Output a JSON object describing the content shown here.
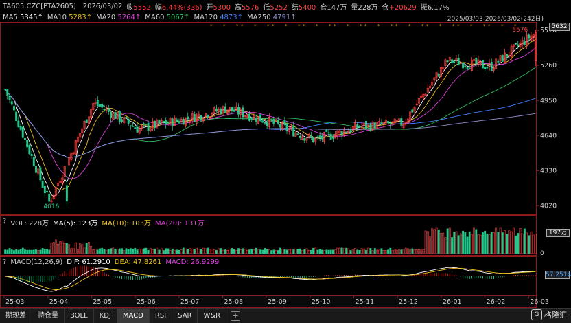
{
  "header": {
    "symbol": "TA605.CZC[PTA2605]",
    "date": "2026/03/02",
    "close_label": "收",
    "close": "5552",
    "change_label": "幅",
    "change": "6.44%(336)",
    "open_label": "开",
    "open": "5300",
    "high_label": "高",
    "high": "5576",
    "low_label": "低",
    "low": "5252",
    "settle_label": "结",
    "settle": "5400",
    "oi_label": "仓",
    "oi": "147万",
    "vol_label": "量",
    "vol": "228万",
    "oichg_label": "仓",
    "oichg": "+20629",
    "amp_label": "振",
    "amp": "6.17%"
  },
  "ma_row": {
    "items": [
      {
        "label": "MA5",
        "value": "5345↑",
        "color": "#ffffff"
      },
      {
        "label": "MA10",
        "value": "5283↑",
        "color": "#f0c020"
      },
      {
        "label": "MA20",
        "value": "5264↑",
        "color": "#e040e0"
      },
      {
        "label": "MA60",
        "value": "5067↑",
        "color": "#30c060"
      },
      {
        "label": "MA120",
        "value": "4873↑",
        "color": "#4080ff"
      },
      {
        "label": "MA250",
        "value": "4791↑",
        "color": "#9090d0"
      }
    ],
    "range_text": "2025/03/03-2026/03/02(242日)"
  },
  "price_axis": [
    "5570",
    "5260",
    "4950",
    "4640",
    "4330",
    "4020"
  ],
  "price_box": "5632",
  "annotations": {
    "high_label": "5576",
    "low_label": "4016"
  },
  "vol_panel": {
    "title": "VOL: 228万",
    "ma5": "MA(5): 123万",
    "ma10": "MA(10): 103万",
    "ma20": "MA(20): 131万",
    "axis_box": "197万",
    "axis_zero": "0"
  },
  "macd_panel": {
    "title": "MACD(12,26,9)",
    "dif": "DIF: 61.2910",
    "dea": "DEA: 47.8261",
    "macd": "MACD: 26.9299",
    "axis_box": "57.2514"
  },
  "date_axis": [
    "25-03",
    "25-04",
    "25-05",
    "25-06",
    "25-07",
    "25-08",
    "25-09",
    "25-10",
    "25-11",
    "25-12",
    "26-01",
    "26-02",
    "26-03"
  ],
  "tabs": [
    "期现差",
    "持仓量",
    "BOLL",
    "KDJ",
    "MACD",
    "RSI",
    "SAR",
    "W&R"
  ],
  "active_tab": "MACD",
  "watermark": "格隆汇",
  "colors": {
    "up": "#ff4040",
    "down": "#24c88c",
    "ma5": "#ffffff",
    "ma10": "#f0c020",
    "ma20": "#e040e0",
    "ma60": "#30c060",
    "ma120": "#4080ff",
    "ma250": "#9090d0"
  },
  "chart_data": {
    "type": "candlestick",
    "title": "TA605.CZC[PTA2605]",
    "x_range": [
      "2025/03/03",
      "2026/03/02"
    ],
    "ylim": [
      4016,
      5632
    ],
    "key_points": [
      {
        "date": "2025/03",
        "close": 5050
      },
      {
        "date": "2025/04",
        "close": 4050,
        "low": 4016
      },
      {
        "date": "2025/05",
        "close": 4930
      },
      {
        "date": "2025/06",
        "close": 4700
      },
      {
        "date": "2025/07",
        "close": 4780
      },
      {
        "date": "2025/08",
        "close": 4880
      },
      {
        "date": "2025/09",
        "close": 4760
      },
      {
        "date": "2025/10",
        "close": 4600
      },
      {
        "date": "2025/11",
        "close": 4720
      },
      {
        "date": "2025/12",
        "close": 4750
      },
      {
        "date": "2026/01",
        "close": 5300
      },
      {
        "date": "2026/02",
        "close": 5250
      },
      {
        "date": "2026/03/02",
        "close": 5552,
        "high": 5576
      }
    ],
    "ma_last": {
      "MA5": 5345,
      "MA10": 5283,
      "MA20": 5264,
      "MA60": 5067,
      "MA120": 4873,
      "MA250": 4791
    },
    "volume_last": "228万",
    "macd_last": {
      "DIF": 61.291,
      "DEA": 47.8261,
      "MACD": 26.9299
    }
  }
}
